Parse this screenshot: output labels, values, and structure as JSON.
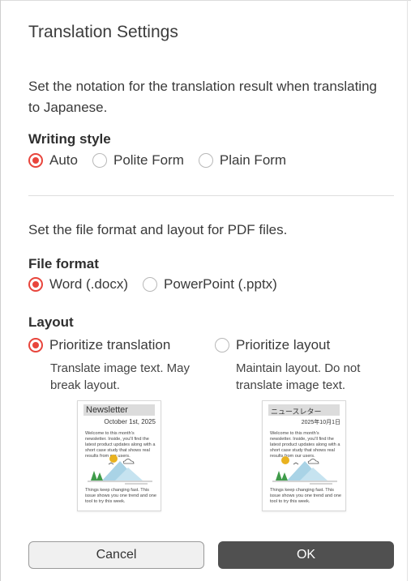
{
  "dialog": {
    "title": "Translation Settings"
  },
  "japanese_section": {
    "description": "Set the notation for the translation result when translating to Japanese.",
    "writing_style": {
      "label": "Writing style",
      "options": [
        {
          "label": "Auto",
          "checked": true
        },
        {
          "label": "Polite Form",
          "checked": false
        },
        {
          "label": "Plain Form",
          "checked": false
        }
      ]
    }
  },
  "pdf_section": {
    "description": "Set the file format and layout for PDF files.",
    "file_format": {
      "label": "File format",
      "options": [
        {
          "label": "Word (.docx)",
          "checked": true
        },
        {
          "label": "PowerPoint (.pptx)",
          "checked": false
        }
      ]
    },
    "layout": {
      "label": "Layout",
      "options": [
        {
          "label": "Prioritize translation",
          "checked": true,
          "description": "Translate image text. May break layout."
        },
        {
          "label": "Prioritize layout",
          "checked": false,
          "description": "Maintain layout. Do not translate image text."
        }
      ]
    }
  },
  "previews": {
    "left": {
      "title": "Newsletter",
      "date": "October 1st, 2025",
      "body": "Welcome to this month's newsletter. Inside, you'll find the latest product updates along with a short case study that shows real results from our users.",
      "footer": "Things keep changing fast. This issue shows you one trend and one tool to try this week."
    },
    "right": {
      "title": "ニュースレター",
      "date": "2025年10月1日",
      "body": "Welcome to this month's newsletter. Inside, you'll find the latest product updates along with a short case study that shows real results from our users.",
      "footer": "Things keep changing fast. This issue shows you one trend and one tool to try this week."
    }
  },
  "buttons": {
    "cancel": "Cancel",
    "ok": "OK"
  },
  "colors": {
    "accent": "#e8453c",
    "ok_button": "#505050"
  }
}
